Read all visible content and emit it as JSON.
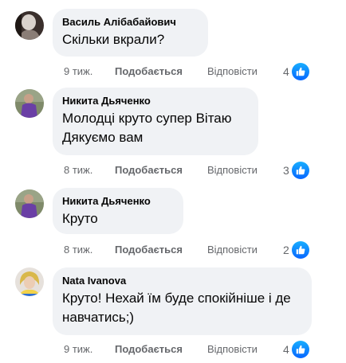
{
  "comments": [
    {
      "author": "Василь Алібабайович",
      "text": "Скільки вкрали?",
      "time": "9 тиж.",
      "like_label": "Подобається",
      "reply_label": "Відповісти",
      "reaction_count": "4",
      "reaction_icon": "like-icon"
    },
    {
      "author": "Никита Дьяченко",
      "text": "Молодці круто супер Вітаю Дякуємо вам",
      "time": "8 тиж.",
      "like_label": "Подобається",
      "reply_label": "Відповісти",
      "reaction_count": "3",
      "reaction_icon": "like-icon"
    },
    {
      "author": "Никита Дьяченко",
      "text": "Круто",
      "time": "8 тиж.",
      "like_label": "Подобається",
      "reply_label": "Відповісти",
      "reaction_count": "2",
      "reaction_icon": "like-icon"
    },
    {
      "author": "Nata Ivanova",
      "text": "Круто! Нехай їм буде спокійніше і де навчатись;)",
      "time": "9 тиж.",
      "like_label": "Подобається",
      "reply_label": "Відповісти",
      "reaction_count": "4",
      "reaction_icon": "like-icon"
    }
  ],
  "colors": {
    "bubble_bg": "#f0f2f5",
    "secondary_text": "#65676b",
    "like_blue": "#0866ff"
  }
}
